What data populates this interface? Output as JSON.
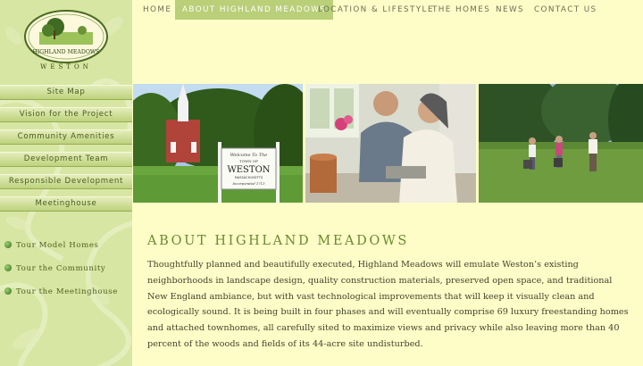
{
  "logo": {
    "name": "HIGHLAND MEADOWS",
    "caption": "WESTON"
  },
  "sidebar": {
    "items": [
      {
        "label": "Site Map"
      },
      {
        "label": "Vision for the Project"
      },
      {
        "label": "Community Amenities"
      },
      {
        "label": "Development Team"
      },
      {
        "label": "Responsible Development"
      },
      {
        "label": "Meetinghouse"
      }
    ],
    "tours": [
      {
        "label": "Tour Model Homes"
      },
      {
        "label": "Tour the Community"
      },
      {
        "label": "Tour the Meetinghouse"
      }
    ]
  },
  "topnav": {
    "items": [
      {
        "label": "HOME"
      },
      {
        "label": "ABOUT HIGHLAND MEADOWS",
        "active": true
      },
      {
        "label": "LOCATION & LIFESTYLE"
      },
      {
        "label": "THE HOMES"
      },
      {
        "label": "NEWS"
      },
      {
        "label": "CONTACT US"
      }
    ]
  },
  "photos": {
    "sign_lines": [
      "Welcome To The",
      "TOWN OF",
      "WESTON",
      "MASSACHUSETTS",
      "Incorporated 1713"
    ]
  },
  "main": {
    "heading": "ABOUT HIGHLAND MEADOWS",
    "body": "Thoughtfully planned and beautifully executed, Highland Meadows will emulate Weston’s existing neighborhoods in landscape design, quality construction materials, preserved open space, and traditional New England ambiance, but with vast technological improvements that will keep it visually clean and ecologically sound. It is being built in four phases and will eventually comprise 69 luxury freestanding homes and attached townhomes, all carefully sited to maximize views and privacy while also leaving more than 40 percent of the woods and fields of its 44-acre site undisturbed."
  },
  "colors": {
    "page_bg": "#fefdc8",
    "sidebar_bg": "#d7e6a2",
    "active_tab": "#b9cf78",
    "heading": "#6a8a2e"
  }
}
